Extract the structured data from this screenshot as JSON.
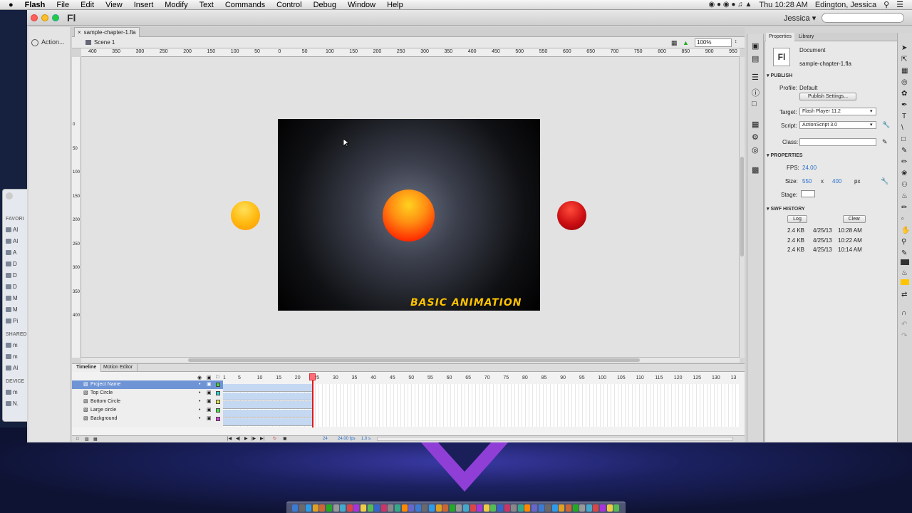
{
  "menubar": {
    "apple": "",
    "app_name": "Flash",
    "items": [
      "File",
      "Edit",
      "View",
      "Insert",
      "Modify",
      "Text",
      "Commands",
      "Control",
      "Debug",
      "Window",
      "Help"
    ],
    "clock": "Thu 10:28 AM",
    "user_name": "Edington, Jessica"
  },
  "app": {
    "logo": "Fl",
    "account": "Jessica ▾",
    "search_placeholder": ""
  },
  "left_panel": {
    "actions_label": "Action..."
  },
  "document": {
    "tab_label": "sample-chapter-1.fla",
    "scene_label": "Scene 1",
    "zoom": "100%",
    "stage_text": "BASIC ANIMATION"
  },
  "rulers": {
    "h_ticks": [
      "400",
      "350",
      "300",
      "250",
      "200",
      "150",
      "100",
      "50",
      "0",
      "50",
      "100",
      "150",
      "200",
      "250",
      "300",
      "350",
      "400",
      "450",
      "500",
      "550",
      "600",
      "650",
      "700",
      "750",
      "800",
      "850",
      "900",
      "950"
    ],
    "v_ticks": [
      "0",
      "50",
      "100",
      "150",
      "200",
      "250",
      "300",
      "350",
      "400"
    ]
  },
  "timeline": {
    "tabs": [
      "Timeline",
      "Motion Editor"
    ],
    "frame_numbers": [
      "1",
      "5",
      "10",
      "15",
      "20",
      "25",
      "30",
      "35",
      "40",
      "45",
      "50",
      "55",
      "60",
      "65",
      "70",
      "75",
      "80",
      "85",
      "90",
      "95",
      "100",
      "105",
      "110",
      "115",
      "120",
      "125",
      "130",
      "13"
    ],
    "layers": [
      {
        "name": "Project Name",
        "color": "#47d447",
        "selected": true
      },
      {
        "name": "Top Circle",
        "color": "#2fd3d3",
        "selected": false
      },
      {
        "name": "Bottom Circle",
        "color": "#e8e84a",
        "selected": false
      },
      {
        "name": "Large circle",
        "color": "#4be24b",
        "selected": false
      },
      {
        "name": "Background",
        "color": "#e040e0",
        "selected": false
      }
    ],
    "footer": {
      "frame": "24",
      "fps": "24.00 fps",
      "time": "1.0 s"
    }
  },
  "properties": {
    "tabs": [
      "Properties",
      "Library"
    ],
    "doc_icon": "Fl",
    "doc_type": "Document",
    "doc_name": "sample-chapter-1.fla",
    "publish_header": "PUBLISH",
    "profile_label": "Profile:",
    "profile_value": "Default",
    "publish_settings_btn": "Publish Settings...",
    "target_label": "Target:",
    "target_value": "Flash Player 11.2",
    "script_label": "Script:",
    "script_value": "ActionScript 3.0",
    "class_label": "Class:",
    "class_value": "",
    "properties_header": "PROPERTIES",
    "fps_label": "FPS:",
    "fps_value": "24.00",
    "size_label": "Size:",
    "size_w": "550",
    "size_x": "x",
    "size_h": "400",
    "size_unit": "px",
    "stage_label": "Stage:",
    "swf_header": "SWF HISTORY",
    "log_btn": "Log",
    "clear_btn": "Clear",
    "history": [
      {
        "size": "2.4 KB",
        "date": "4/25/13",
        "time": "10:28 AM"
      },
      {
        "size": "2.4 KB",
        "date": "4/25/13",
        "time": "10:22 AM"
      },
      {
        "size": "2.4 KB",
        "date": "4/25/13",
        "time": "10:14 AM"
      }
    ]
  },
  "finder": {
    "favorites_label": "FAVORI",
    "favorites": [
      "Al",
      "Al",
      "A",
      "D",
      "D",
      "D",
      "M",
      "M",
      "Pi"
    ],
    "shared_label": "SHARED",
    "shared": [
      "m",
      "m",
      "Al"
    ],
    "devices_label": "DEVICE",
    "devices": [
      "m",
      "N."
    ]
  },
  "colors": {
    "accent": "#6f94d6",
    "playhead": "#e0181b",
    "stage_title": "#ffc400"
  }
}
